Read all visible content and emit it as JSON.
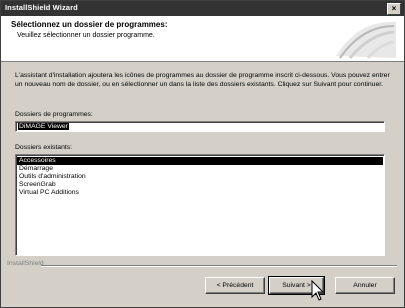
{
  "window": {
    "title": "InstallShield Wizard",
    "close_glyph": "×"
  },
  "header": {
    "title": "Sélectionnez un dossier de programmes:",
    "subtitle": "Veuillez sélectionner un dossier programme."
  },
  "instructions": "L'assistant d'installation ajoutera les icônes de programmes au dossier de programme inscrit ci-dessous. Vous pouvez entrer un nouveau nom de dossier, ou en sélectionner un dans la liste des dossiers existants. Cliquez sur Suivant pour continuer.",
  "program_folder": {
    "label": "Dossiers de programmes:",
    "value": "DiMAGE Viewer"
  },
  "existing_folders": {
    "label": "Dossiers existants:",
    "items": [
      "Accessoires",
      "Démarrage",
      "Outils d'administration",
      "ScreenGrab",
      "Virtual PC Additions"
    ],
    "selected_index": 0
  },
  "footer": {
    "brand": "InstallShield"
  },
  "buttons": {
    "back": "< Précédent",
    "next": "Suivant >",
    "cancel": "Annuler"
  },
  "icons": {
    "close": "close-icon",
    "cursor": "mouse-pointer-icon",
    "header_graphic": "swoosh-graphic-icon"
  },
  "colors": {
    "titlebar": "#333333",
    "dialog": "#d4d0c8",
    "selection": "#000000"
  }
}
